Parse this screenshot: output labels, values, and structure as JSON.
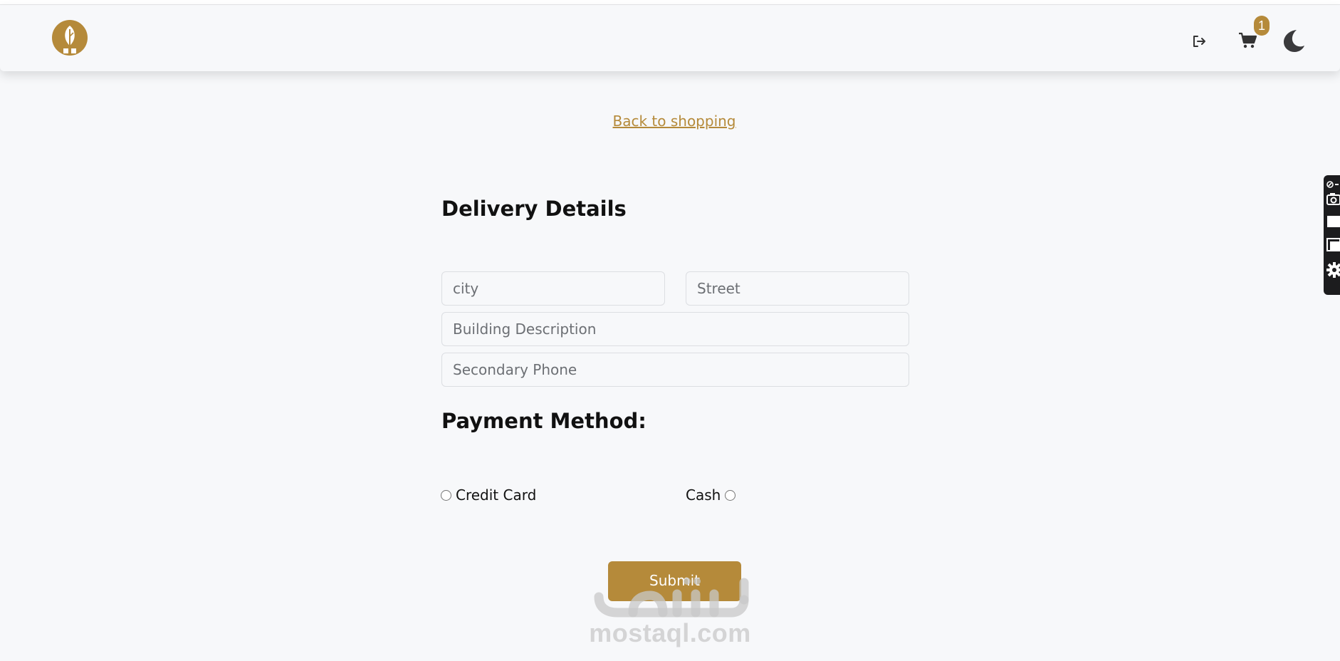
{
  "navbar": {
    "logo_icon": "leaf-logo-icon",
    "logout_icon": "logout-icon",
    "cart_icon": "cart-icon",
    "cart_count": "1",
    "theme_icon": "moon-icon"
  },
  "back_link": "Back to shopping",
  "delivery": {
    "title": "Delivery Details",
    "city_placeholder": "city",
    "street_placeholder": "Street",
    "building_placeholder": "Building Description",
    "phone_placeholder": "Secondary Phone"
  },
  "payment": {
    "title": "Payment Method:",
    "credit_label": "Credit Card",
    "cash_label": "Cash"
  },
  "submit_label": "Submit",
  "watermark": {
    "text": "mostaql.com"
  },
  "side_toolbar": {
    "icons": [
      "extension-icon",
      "camera-icon",
      "window-icon",
      "fullscreen-icon",
      "gear-icon"
    ]
  },
  "colors": {
    "accent": "#b58a3a",
    "background": "#f7f8fa",
    "text": "#111111"
  }
}
